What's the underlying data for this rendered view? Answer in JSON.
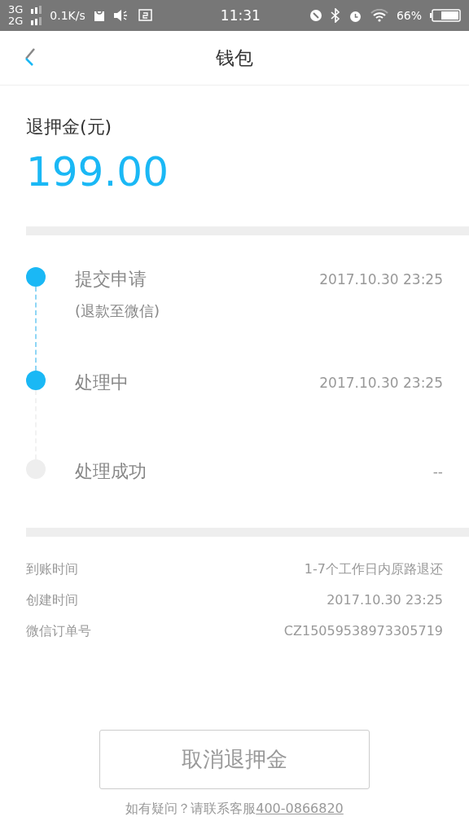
{
  "status_bar": {
    "network_top": "3G",
    "network_bottom": "2G",
    "speed": "0.1K/s",
    "time": "11:31",
    "battery": "66%"
  },
  "nav": {
    "title": "钱包"
  },
  "deposit": {
    "label": "退押金(元)",
    "amount": "199.00"
  },
  "timeline": [
    {
      "title": "提交申请",
      "note": "(退款至微信)",
      "time": "2017.10.30 23:25",
      "done": true
    },
    {
      "title": "处理中",
      "time": "2017.10.30 23:25",
      "done": true
    },
    {
      "title": "处理成功",
      "time": "--",
      "done": false
    }
  ],
  "details": [
    {
      "label": "到账时间",
      "value": "1-7个工作日内原路退还"
    },
    {
      "label": "创建时间",
      "value": "2017.10.30 23:25"
    },
    {
      "label": "微信订单号",
      "value": "CZ15059538973305719"
    }
  ],
  "cancel_button": "取消退押金",
  "help": {
    "text": "如有疑问？请联系客服",
    "phone": "400-0866820"
  }
}
